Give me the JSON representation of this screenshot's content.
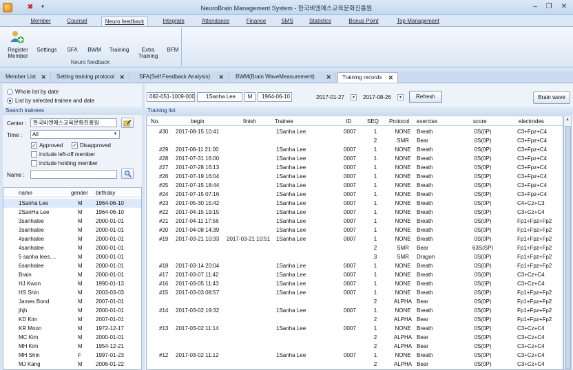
{
  "window": {
    "title": "NeuroBrain Management System - 한국비엔에스교육문화진흥원"
  },
  "ribbon_tabs": [
    "Member",
    "Counsel",
    "Neuro feedback",
    "Integrate",
    "Attendance",
    "Finance",
    "SMS",
    "Statistics",
    "Bonus Point",
    "Top Management"
  ],
  "ribbon": {
    "register_member": "Register Member",
    "buttons": [
      "Settings",
      "SFA",
      "BWM",
      "Training",
      "Extra Training",
      "BFM"
    ],
    "group_label": "Neuro feedback"
  },
  "doc_tabs": [
    "Member List",
    "Setting training protocol",
    "SFA(Self Feedback Analysis)",
    "BWM(Brain WaveMeasurement)",
    "Training records"
  ],
  "left": {
    "radio_whole": "Whole list by date",
    "radio_selected": "List by selected trainee and date",
    "search_title": "Search trainees",
    "center_label": "Center :",
    "center_value": "한국비엔에스교육문화진흥원",
    "time_label": "Time :",
    "time_value": "All",
    "approved": "Approved",
    "disapproved": "Disapproved",
    "include_leftoff": "include left-off member",
    "include_holding": "include holding member",
    "name_label": "Name :",
    "columns": [
      "name",
      "gender",
      "birthday"
    ],
    "trainees": [
      [
        "1Sanha Lee",
        "M",
        "1964-06-10"
      ],
      [
        "2SanHa Lee",
        "M",
        "1964-06-10"
      ],
      [
        "3sanhalee",
        "M",
        "2000-01-01"
      ],
      [
        "3sanhalee",
        "M",
        "2000-01-01"
      ],
      [
        "4sanhalee",
        "M",
        "2000-01-01"
      ],
      [
        "4sanhalee",
        "M",
        "2000-01-01"
      ],
      [
        "5 sanha lees....",
        "M",
        "2000-01-01"
      ],
      [
        "6sanhalee",
        "M",
        "2000-01-01"
      ],
      [
        "Brain",
        "M",
        "2000-01-01"
      ],
      [
        "HJ Kwon",
        "M",
        "1990-01-13"
      ],
      [
        "HS Shin",
        "M",
        "2003-03-03"
      ],
      [
        "James Bond",
        "M",
        "2007-01-01"
      ],
      [
        "jhjh",
        "M",
        "2000-01-01"
      ],
      [
        "KD Kim",
        "M",
        "2007-01-01"
      ],
      [
        "KR Moon",
        "M",
        "1972-12-17"
      ],
      [
        "MC Kim",
        "M",
        "2000-01-01"
      ],
      [
        "MH Kim",
        "M",
        "1954-12-21"
      ],
      [
        "MH Shin",
        "F",
        "1997-01-23"
      ],
      [
        "MJ Kang",
        "M",
        "2006-01-22"
      ]
    ]
  },
  "right": {
    "member_id": "082-051-1009-0007",
    "member_name": "1Sanha Lee",
    "member_gender": "M",
    "member_birthday": "1964-06-10",
    "date_from": "2017-01-27",
    "date_to": "2017-08-26",
    "refresh": "Refresh",
    "brain_wave": "Brain wave",
    "list_title": "Training list",
    "columns": [
      "No.",
      "begin",
      "finish",
      "Trainee",
      "ID",
      "SEQ",
      "Protocol",
      "exercise",
      "score",
      "electrodes"
    ],
    "rows": [
      [
        "#30",
        "2017-08-15 10:41",
        "",
        "1Sanha Lee",
        "0007",
        "1",
        "NONE",
        "Breath",
        "0S(0P)",
        "C3+Fpz+C4"
      ],
      [
        "",
        "",
        "",
        "",
        "",
        "2",
        "SMR",
        "Bear",
        "0S(0P)",
        "C3+Fpz+C4"
      ],
      [
        "#29",
        "2017-08-11 21:00",
        "",
        "1Sanha Lee",
        "0007",
        "1",
        "NONE",
        "Breath",
        "0S(0P)",
        "C3+Fpz+C4"
      ],
      [
        "#28",
        "2017-07-31 16:00",
        "",
        "1Sanha Lee",
        "0007",
        "1",
        "NONE",
        "Breath",
        "0S(0P)",
        "C3+Fpz+C4"
      ],
      [
        "#27",
        "2017-07-28 16:13",
        "",
        "1Sanha Lee",
        "0007",
        "1",
        "NONE",
        "Breath",
        "0S(0P)",
        "C3+Fpz+C4"
      ],
      [
        "#26",
        "2017-07-19 16:04",
        "",
        "1Sanha Lee",
        "0007",
        "1",
        "NONE",
        "Breath",
        "0S(0P)",
        "C3+Fpz+C4"
      ],
      [
        "#25",
        "2017-07-15 18:44",
        "",
        "1Sanha Lee",
        "0007",
        "1",
        "NONE",
        "Breath",
        "0S(0P)",
        "C3+Fpz+C4"
      ],
      [
        "#24",
        "2017-07-15 07:16",
        "",
        "1Sanha Lee",
        "0007",
        "1",
        "NONE",
        "Breath",
        "0S(0P)",
        "C3+Fpz+C4"
      ],
      [
        "#23",
        "2017-05-30 15:42",
        "",
        "1Sanha Lee",
        "0007",
        "1",
        "NONE",
        "Breath",
        "0S(0P)",
        "C4+Cz+C3"
      ],
      [
        "#22",
        "2017-04-15 19:15",
        "",
        "1Sanha Lee",
        "0007",
        "1",
        "NONE",
        "Breath",
        "0S(0P)",
        "C3+Cz+C4"
      ],
      [
        "#21",
        "2017-04-11 17:56",
        "",
        "1Sanha Lee",
        "0007",
        "1",
        "NONE",
        "Breath",
        "0S(0P)",
        "Fp1+Fpz+Fp2"
      ],
      [
        "#20",
        "2017-04-08 14:39",
        "",
        "1Sanha Lee",
        "0007",
        "1",
        "NONE",
        "Breath",
        "0S(0P)",
        "Fp1+Fpz+Fp2"
      ],
      [
        "#19",
        "2017-03-21 10:33",
        "2017-03-21 10:51",
        "1Sanha Lee",
        "0007",
        "1",
        "NONE",
        "Breath",
        "0S(0P)",
        "Fp1+Fpz+Fp2"
      ],
      [
        "",
        "",
        "",
        "",
        "",
        "2",
        "SMR",
        "Bear",
        "63S(SP)",
        "Fp1+Fpz+Fp2"
      ],
      [
        "",
        "",
        "",
        "",
        "",
        "3",
        "SMR",
        "Dragon",
        "0S(0P)",
        "Fp1+Fpz+Fp2"
      ],
      [
        "#18",
        "2017-03-14 20:04",
        "",
        "1Sanha Lee",
        "0007",
        "1",
        "NONE",
        "Breath",
        "0S(0P)",
        "Fp1+Fpz+Fp2"
      ],
      [
        "#17",
        "2017-03-07 11:42",
        "",
        "1Sanha Lee",
        "0007",
        "1",
        "NONE",
        "Breath",
        "0S(0P)",
        "C3+Cz+C4"
      ],
      [
        "#16",
        "2017-03-05 11:43",
        "",
        "1Sanha Lee",
        "0007",
        "1",
        "NONE",
        "Breath",
        "0S(0P)",
        "C3+Cz+C4"
      ],
      [
        "#15",
        "2017-03-03 08:57",
        "",
        "1Sanha Lee",
        "0007",
        "1",
        "NONE",
        "Breath",
        "0S(0P)",
        "Fp1+Fpz+Fp2"
      ],
      [
        "",
        "",
        "",
        "",
        "",
        "2",
        "ALPHA",
        "Bear",
        "0S(0P)",
        "Fp1+Fpz+Fp2"
      ],
      [
        "#14",
        "2017-03-02 19:32",
        "",
        "1Sanha Lee",
        "0007",
        "1",
        "NONE",
        "Breath",
        "0S(0P)",
        "Fp1+Fpz+Fp2"
      ],
      [
        "",
        "",
        "",
        "",
        "",
        "2",
        "ALPHA",
        "Bear",
        "0S(0P)",
        "Fp1+Fpz+Fp2"
      ],
      [
        "#13",
        "2017-03-02 11:14",
        "",
        "1Sanha Lee",
        "0007",
        "1",
        "NONE",
        "Breath",
        "0S(0P)",
        "C3+Cz+C4"
      ],
      [
        "",
        "",
        "",
        "",
        "",
        "2",
        "ALPHA",
        "Bear",
        "0S(0P)",
        "C3+Cz+C4"
      ],
      [
        "",
        "",
        "",
        "",
        "",
        "2",
        "ALPHA",
        "Bear",
        "0S(0P)",
        "C3+Cz+C4"
      ],
      [
        "#12",
        "2017-03-02 11:12",
        "",
        "1Sanha Lee",
        "0007",
        "1",
        "NONE",
        "Breath",
        "0S(0P)",
        "C3+Cz+C4"
      ],
      [
        "",
        "",
        "",
        "",
        "",
        "2",
        "ALPHA",
        "Bear",
        "0S(0P)",
        "C3+Cz+C4"
      ]
    ]
  }
}
